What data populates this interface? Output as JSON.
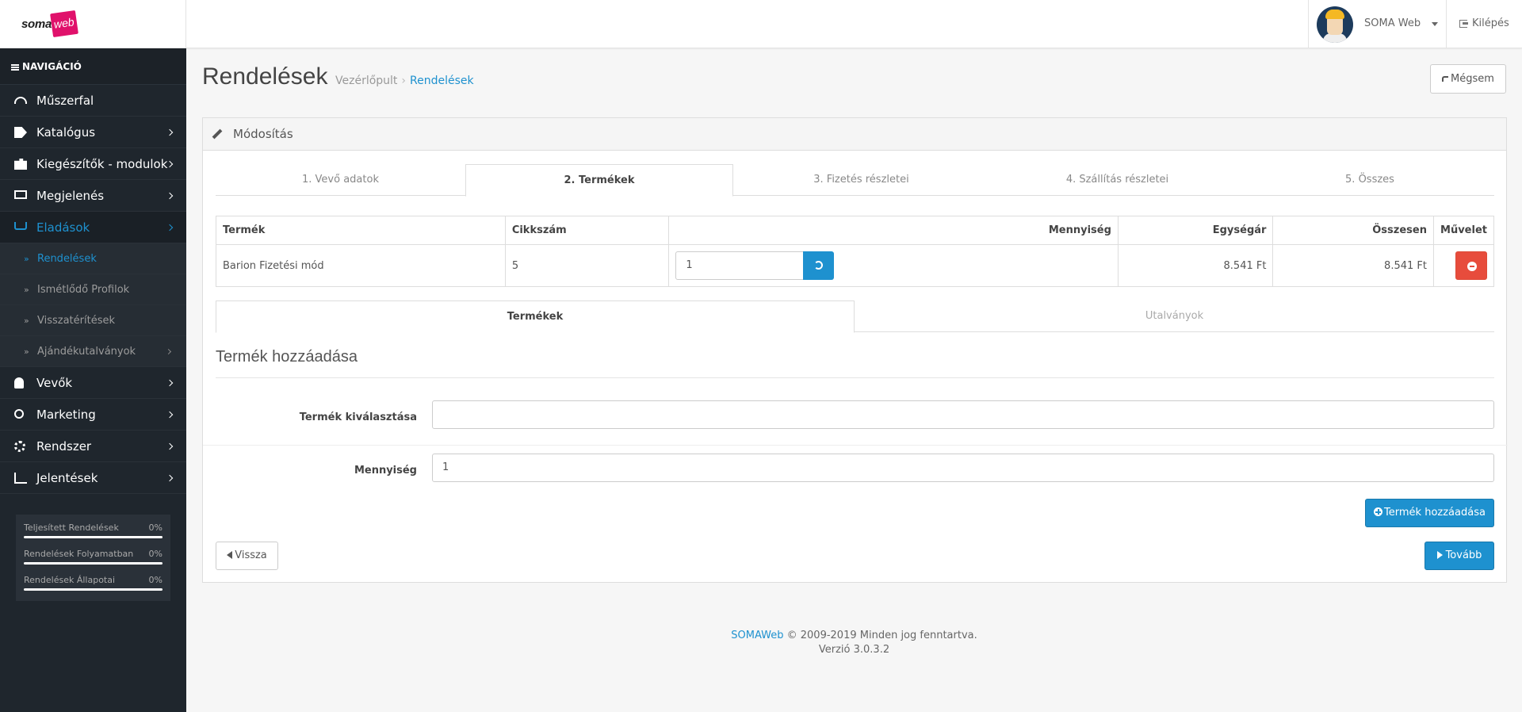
{
  "header": {
    "logo_text": "soma",
    "logo_badge": "web",
    "user_name": "SOMA Web",
    "logout_label": "Kilépés"
  },
  "sidebar": {
    "heading": "NAVIGÁCIÓ",
    "items": [
      {
        "label": "Műszerfal",
        "icon": "dashboard-icon"
      },
      {
        "label": "Katalógus",
        "icon": "tags-icon"
      },
      {
        "label": "Kiegészítők - modulok",
        "icon": "puzzle-icon"
      },
      {
        "label": "Megjelenés",
        "icon": "monitor-icon"
      },
      {
        "label": "Eladások",
        "icon": "cart-icon"
      },
      {
        "label": "Vevők",
        "icon": "user-icon"
      },
      {
        "label": "Marketing",
        "icon": "share-icon"
      },
      {
        "label": "Rendszer",
        "icon": "cog-icon"
      },
      {
        "label": "Jelentések",
        "icon": "bar-chart-icon"
      }
    ],
    "sales_sub": [
      {
        "label": "Rendelések"
      },
      {
        "label": "Ismétlődő Profilok"
      },
      {
        "label": "Visszatérítések"
      },
      {
        "label": "Ajándékutalványok"
      }
    ],
    "stats": [
      {
        "label": "Teljesített Rendelések",
        "value": "0%",
        "progress": 0
      },
      {
        "label": "Rendelések Folyamatban",
        "value": "0%",
        "progress": 0
      },
      {
        "label": "Rendelések Állapotai",
        "value": "0%",
        "progress": 0
      }
    ]
  },
  "page": {
    "title": "Rendelések",
    "breadcrumb": [
      "Vezérlőpult",
      "Rendelések"
    ],
    "breadcrumb_sep": "›",
    "cancel_label": "Mégsem"
  },
  "panel": {
    "heading": "Módosítás",
    "steps": [
      "1. Vevő adatok",
      "2. Termékek",
      "3. Fizetés részletei",
      "4. Szállítás részletei",
      "5. Összes"
    ],
    "active_step": 1,
    "table": {
      "headers": [
        "Termék",
        "Cikkszám",
        "Mennyiség",
        "Egységár",
        "Összesen",
        "Művelet"
      ],
      "rows": [
        {
          "product": "Barion Fizetési mód",
          "sku": "5",
          "quantity": "1",
          "unit_price": "8.541 Ft",
          "total": "8.541 Ft"
        }
      ]
    },
    "sub_tabs": [
      "Termékek",
      "Utalványok"
    ],
    "legend": "Termék hozzáadása",
    "form": {
      "product_label": "Termék kiválasztása",
      "product_value": "",
      "quantity_label": "Mennyiség",
      "quantity_value": "1"
    },
    "add_product_label": "Termék hozzáadása",
    "back_label": "Vissza",
    "next_label": "Tovább"
  },
  "footer": {
    "brand": "SOMAWeb",
    "copyright": "© 2009-2019 Minden jog fenntartva.",
    "version": "Verzió 3.0.3.2"
  },
  "colors": {
    "accent": "#1e91cf",
    "sidebar_bg": "#1f262d",
    "danger": "#e74c3c",
    "logo_pink": "#e0116b"
  }
}
